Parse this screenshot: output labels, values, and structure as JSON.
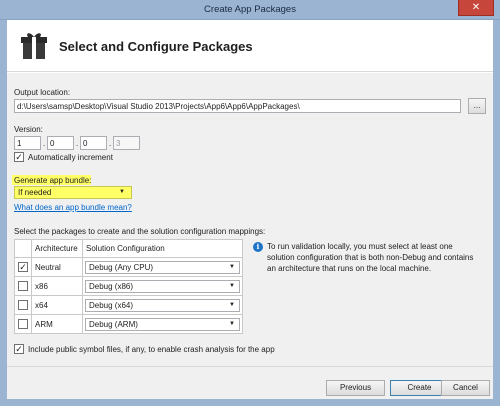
{
  "window": {
    "title": "Create App Packages",
    "close_glyph": "✕"
  },
  "header": {
    "heading": "Select and Configure Packages"
  },
  "output": {
    "label": "Output location:",
    "value": "d:\\Users\\samsp\\Desktop\\Visual Studio 2013\\Projects\\App6\\App6\\AppPackages\\",
    "browse_label": "..."
  },
  "version": {
    "label": "Version:",
    "major": "1",
    "minor": "0",
    "build": "0",
    "revision": "3",
    "sep": ".",
    "auto_increment_label": "Automatically increment",
    "auto_increment_checked": true
  },
  "bundle": {
    "label": "Generate app bundle:",
    "selected": "If needed",
    "help_link": "What does an app bundle mean?"
  },
  "packages": {
    "instruction": "Select the packages to create and the solution configuration mappings:",
    "columns": [
      "Architecture",
      "Solution Configuration"
    ],
    "rows": [
      {
        "checked": "✓",
        "arch": "Neutral",
        "config": "Debug (Any CPU)"
      },
      {
        "checked": "",
        "arch": "x86",
        "config": "Debug (x86)"
      },
      {
        "checked": "",
        "arch": "x64",
        "config": "Debug (x64)"
      },
      {
        "checked": "",
        "arch": "ARM",
        "config": "Debug (ARM)"
      }
    ],
    "info_text": "To run validation locally, you must select at least one solution configuration that is both non-Debug and contains an architecture that runs on the local machine."
  },
  "symbols": {
    "label": "Include public symbol files, if any, to enable crash analysis for the app",
    "checked": true
  },
  "buttons": {
    "previous": "Previous",
    "create": "Create",
    "cancel": "Cancel"
  },
  "check_glyph": "✓",
  "dropdown_arrow": "▼",
  "info_glyph": "i",
  "colors": {
    "highlight": "#ffff66",
    "link": "#0066cc",
    "title_bar": "#9bb4d2",
    "close": "#c7463b"
  }
}
